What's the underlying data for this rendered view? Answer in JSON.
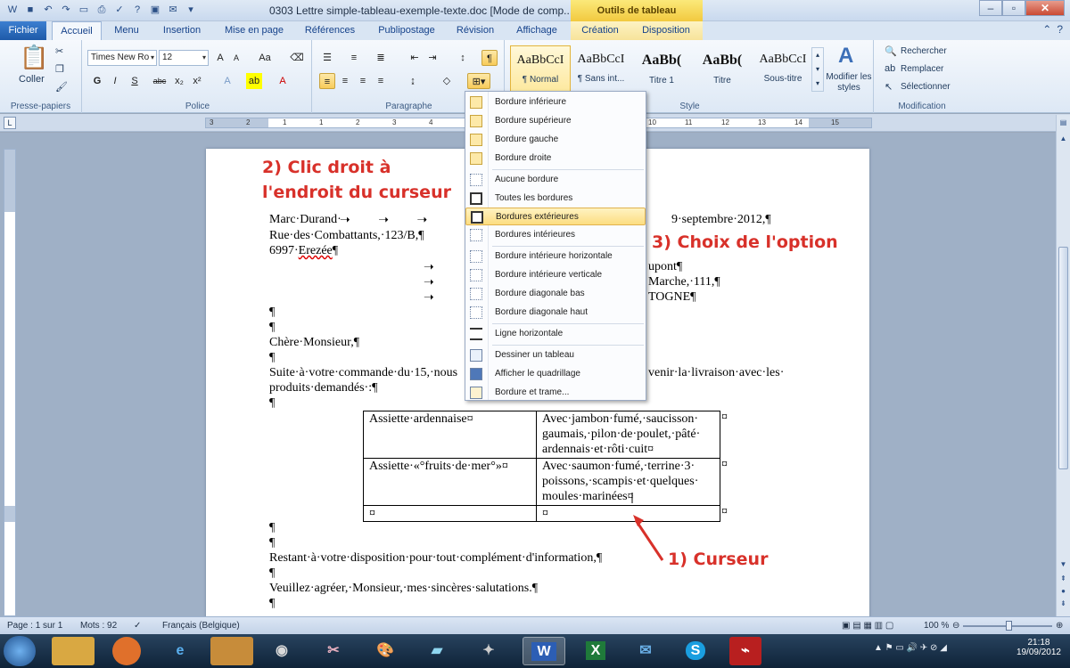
{
  "window": {
    "title": "0303 Lettre simple-tableau-exemple-texte.doc [Mode de comp...",
    "context_tab_header": "Outils de tableau"
  },
  "tabs": {
    "file": "Fichier",
    "items": [
      "Accueil",
      "Menu",
      "Insertion",
      "Mise en page",
      "Références",
      "Publipostage",
      "Révision",
      "Affichage",
      "Création",
      "Disposition"
    ]
  },
  "ribbon": {
    "clipboard": {
      "paste": "Coller",
      "label": "Presse-papiers"
    },
    "font": {
      "name": "Times New Ro",
      "size": "12",
      "label": "Police"
    },
    "paragraph": {
      "label": "Paragraphe"
    },
    "styles": {
      "label": "Style",
      "items": [
        {
          "preview": "AaBbCcI",
          "name": "¶ Normal"
        },
        {
          "preview": "AaBbCcI",
          "name": "¶ Sans int..."
        },
        {
          "preview": "AaBb(",
          "name": "Titre 1"
        },
        {
          "preview": "AaBb(",
          "name": "Titre"
        },
        {
          "preview": "AaBbCcI",
          "name": "Sous-titre"
        }
      ],
      "modify": "Modifier les styles"
    },
    "editing": {
      "label": "Modification",
      "find": "Rechercher",
      "replace": "Remplacer",
      "select": "Sélectionner"
    }
  },
  "ruler_ticks": [
    "3",
    "2",
    "1",
    "1",
    "2",
    "3",
    "4",
    "5",
    "6",
    "7",
    "8",
    "9",
    "10",
    "11",
    "12",
    "13",
    "14",
    "15"
  ],
  "document": {
    "lines": {
      "l1a": "Marc·Durand·",
      "l1b": "9·septembre·2012,¶",
      "l2": "Rue·des·Combattants,·123/B,¶",
      "l3a": "6997·",
      "l3b": "Erezée",
      "l3c": "¶",
      "r1": "upont¶",
      "r2": "Marche,·111,¶",
      "r3": "TOGNE¶",
      "p1": "¶",
      "p2": "¶",
      "greet": "Chère·Monsieur,¶",
      "p3": "¶",
      "body1a": "Suite·à·votre·commande·du·15,·nous",
      "body1b": "venir·la·livraison·avec·les·",
      "body2": "produits·demandés·:¶",
      "p4": "¶",
      "p5": "¶",
      "p6": "¶",
      "closing": "Restant·à·votre·disposition·pour·tout·complément·d'information,¶",
      "p7": "¶",
      "salut": "Veuillez·agréer,·Monsieur,·mes·sincères·salutations.¶",
      "p8": "¶"
    },
    "table": [
      [
        "Assiette·ardennaise¤",
        "Avec·jambon·fumé,·saucisson· gaumais,·pilon·de·poulet,·pâté· ardennais·et·rôti·cuit¤"
      ],
      [
        "Assiette·«°fruits·de·mer°»¤",
        "Avec·saumon·fumé,·terrine·3· poissons,·scampis·et·quelques· moules·marinées¤"
      ],
      [
        "¤",
        "¤"
      ]
    ],
    "row_end": "¤"
  },
  "annotations": {
    "a1": "2) Clic droit à",
    "a1b": "l'endroit du curseur",
    "a2": "3) Choix de l'option",
    "a3": "1) Curseur"
  },
  "border_menu": [
    "Bordure inférieure",
    "Bordure supérieure",
    "Bordure gauche",
    "Bordure droite",
    "Aucune bordure",
    "Toutes les bordures",
    "Bordures extérieures",
    "Bordures intérieures",
    "Bordure intérieure horizontale",
    "Bordure intérieure verticale",
    "Bordure diagonale bas",
    "Bordure diagonale haut",
    "Ligne horizontale",
    "Dessiner un tableau",
    "Afficher le quadrillage",
    "Bordure et trame..."
  ],
  "status": {
    "page": "Page : 1 sur 1",
    "words": "Mots : 92",
    "lang": "Français (Belgique)",
    "zoom": "100 %"
  },
  "taskbar": {
    "time": "21:18",
    "date": "19/09/2012",
    "apps": [
      "W",
      "X",
      "S"
    ]
  }
}
